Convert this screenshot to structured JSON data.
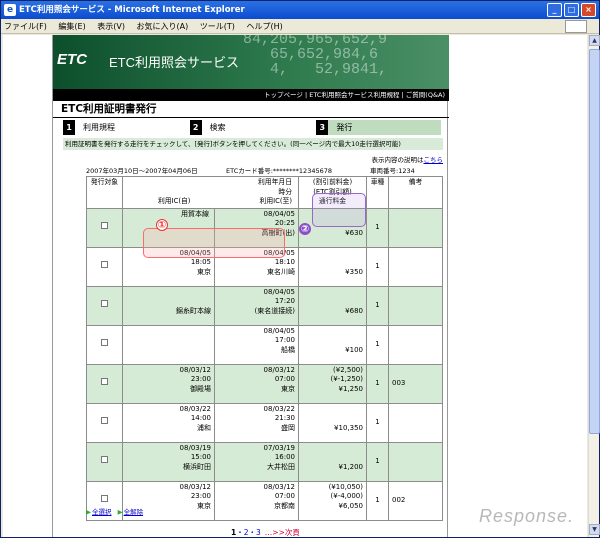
{
  "window": {
    "title": "ETC利用照会サービス - Microsoft Internet Explorer",
    "minimize": "_",
    "maximize": "□",
    "close": "×"
  },
  "menu": [
    "ファイル(F)",
    "編集(E)",
    "表示(V)",
    "お気に入り(A)",
    "ツール(T)",
    "ヘルプ(H)"
  ],
  "banner": {
    "logo": "ETC",
    "service": "ETC利用照会サービス",
    "digits": "84,205,965,652,9\n   65,652,984,6\n   4,   52,9841,"
  },
  "breadcrumb": "トップページ | ETC利用照会サービス利用規程 | ご質問(Q&A)",
  "heading": "ETC利用証明書発行",
  "steps": [
    {
      "num": "1",
      "label": "利用規程"
    },
    {
      "num": "2",
      "label": "検索"
    },
    {
      "num": "3",
      "label": "発行"
    }
  ],
  "notice": "利用証明書を発行する走行をチェックして、[発行]ボタンを押してください。(同一ページ内で最大10走行選択可能)",
  "help": {
    "prefix": "表示内容の説明は",
    "link": "こちら"
  },
  "info": {
    "period": "2007年03月10日～2007年04月06日",
    "card": "ETCカード番号:********12345678",
    "vehicle": "車両番号:1234"
  },
  "table": {
    "headers": {
      "select": "発行対象",
      "datetime": "利用年月日",
      "time": "時分",
      "ic_from": "利用IC(自)",
      "ic_to": "利用IC(至)",
      "fare1": "(割引前料金)",
      "fare2": "(ETC割引額)",
      "fare3": "通行料金",
      "vehicle": "車種",
      "note": "備考"
    },
    "rows": [
      {
        "in": [
          "",
          ""
        ],
        "out": [
          "08/04/05",
          "20:25"
        ],
        "from": "用賀本線",
        "to": "高樹町(出)",
        "fare": [
          "",
          "",
          "¥630"
        ],
        "veh": "1",
        "note": ""
      },
      {
        "in": [
          "08/04/05",
          "18:05"
        ],
        "out": [
          "08/04/05",
          "18:10"
        ],
        "from": "東京",
        "to": "東名川崎",
        "fare": [
          "",
          "",
          "¥350"
        ],
        "veh": "1",
        "note": ""
      },
      {
        "in": [
          "",
          ""
        ],
        "out": [
          "08/04/05",
          "17:20"
        ],
        "from": "錦糸町本線",
        "to": "(東名道接続)",
        "fare": [
          "",
          "",
          "¥680"
        ],
        "veh": "1",
        "note": ""
      },
      {
        "in": [
          "",
          ""
        ],
        "out": [
          "08/04/05",
          "17:00"
        ],
        "from": "",
        "to": "船橋",
        "fare": [
          "",
          "",
          "¥100"
        ],
        "veh": "1",
        "note": ""
      },
      {
        "in": [
          "08/03/12",
          "23:00"
        ],
        "out": [
          "08/03/12",
          "07:00"
        ],
        "from": "御殿場",
        "to": "東京",
        "fare": [
          "(¥2,500)",
          "(¥-1,250)",
          "¥1,250"
        ],
        "veh": "1",
        "note": "003"
      },
      {
        "in": [
          "08/03/22",
          "14:00"
        ],
        "out": [
          "08/03/22",
          "21:30"
        ],
        "from": "浦和",
        "to": "盛岡",
        "fare": [
          "",
          "",
          "¥10,350"
        ],
        "veh": "1",
        "note": ""
      },
      {
        "in": [
          "08/03/19",
          "15:00"
        ],
        "out": [
          "07/03/19",
          "16:00"
        ],
        "from": "横浜町田",
        "to": "大井松田",
        "fare": [
          "",
          "",
          "¥1,200"
        ],
        "veh": "1",
        "note": ""
      },
      {
        "in": [
          "08/03/12",
          "23:00"
        ],
        "out": [
          "08/03/12",
          "07:00"
        ],
        "from": "東京",
        "to": "京都南",
        "fare": [
          "(¥10,050)",
          "(¥-4,000)",
          "¥6,050"
        ],
        "veh": "1",
        "note": "002"
      }
    ]
  },
  "annotations": {
    "one": "①",
    "two": "②"
  },
  "select": {
    "all": "全選択",
    "clear": "全解除"
  },
  "pager": {
    "p1": "1",
    "sep1": "・",
    "p2": "2",
    "sep2": "・",
    "p3": "3",
    "next": "…>>次頁"
  },
  "watermark": "Response."
}
